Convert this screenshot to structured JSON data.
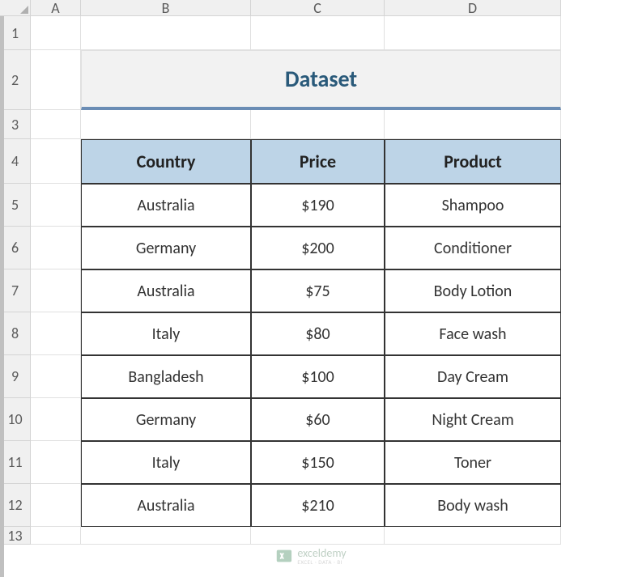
{
  "columns": [
    "A",
    "B",
    "C",
    "D"
  ],
  "rows": [
    "1",
    "2",
    "3",
    "4",
    "5",
    "6",
    "7",
    "8",
    "9",
    "10",
    "11",
    "12",
    "13"
  ],
  "title": "Dataset",
  "table": {
    "headers": [
      "Country",
      "Price",
      "Product"
    ],
    "rows": [
      {
        "country": "Australia",
        "price": "$190",
        "product": "Shampoo"
      },
      {
        "country": "Germany",
        "price": "$200",
        "product": "Conditioner"
      },
      {
        "country": "Australia",
        "price": "$75",
        "product": "Body Lotion"
      },
      {
        "country": "Italy",
        "price": "$80",
        "product": "Face wash"
      },
      {
        "country": "Bangladesh",
        "price": "$100",
        "product": "Day Cream"
      },
      {
        "country": "Germany",
        "price": "$60",
        "product": "Night Cream"
      },
      {
        "country": "Italy",
        "price": "$150",
        "product": "Toner"
      },
      {
        "country": "Australia",
        "price": "$210",
        "product": "Body wash"
      }
    ]
  },
  "watermark": {
    "name": "exceldemy",
    "tagline": "EXCEL · DATA · BI"
  },
  "chart_data": {
    "type": "table",
    "title": "Dataset",
    "columns": [
      "Country",
      "Price",
      "Product"
    ],
    "rows": [
      [
        "Australia",
        190,
        "Shampoo"
      ],
      [
        "Germany",
        200,
        "Conditioner"
      ],
      [
        "Australia",
        75,
        "Body Lotion"
      ],
      [
        "Italy",
        80,
        "Face wash"
      ],
      [
        "Bangladesh",
        100,
        "Day Cream"
      ],
      [
        "Germany",
        60,
        "Night Cream"
      ],
      [
        "Italy",
        150,
        "Toner"
      ],
      [
        "Australia",
        210,
        "Body wash"
      ]
    ]
  }
}
